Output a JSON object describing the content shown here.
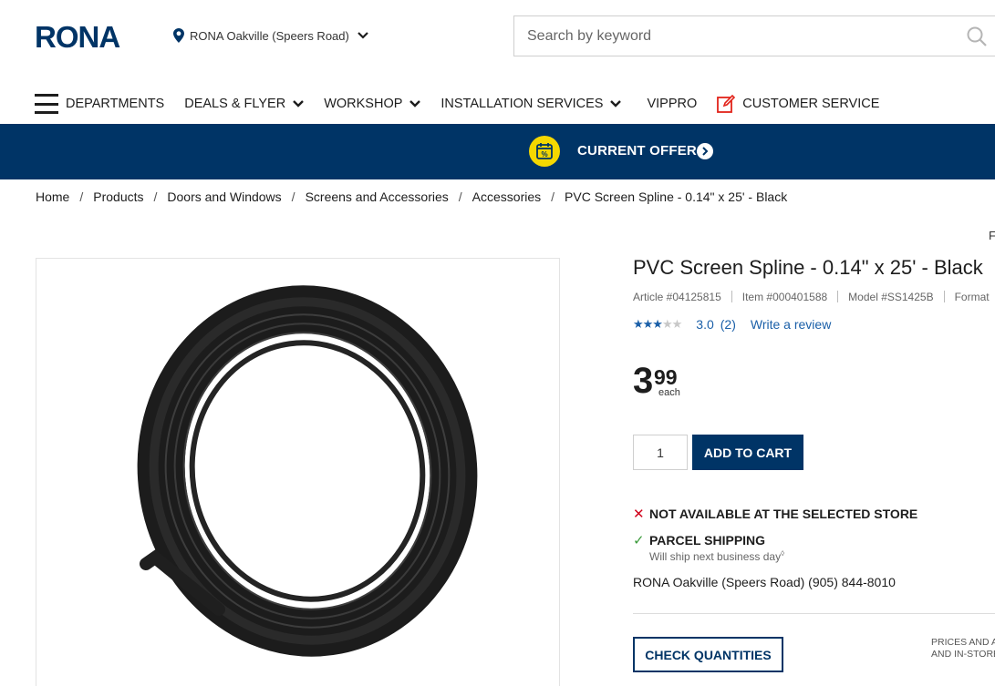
{
  "header": {
    "logo_text": "RONA",
    "store_name": "RONA Oakville (Speers Road)",
    "search_placeholder": "Search by keyword"
  },
  "nav": {
    "items": [
      {
        "label": "DEPARTMENTS",
        "icon": "hamburger-menu-icon"
      },
      {
        "label": "DEALS & FLYER",
        "icon": "chevron-down-icon"
      },
      {
        "label": "WORKSHOP",
        "icon": "chevron-down-icon"
      },
      {
        "label": "INSTALLATION SERVICES",
        "icon": "chevron-down-icon"
      },
      {
        "label": "VIPPRO",
        "icon": ""
      },
      {
        "label": "CUSTOMER SERVICE",
        "icon": "edit-icon"
      }
    ]
  },
  "offers": {
    "label": "CURRENT OFFERS",
    "colors": {
      "bar": "#003466",
      "badge": "#f5d800"
    }
  },
  "breadcrumb": [
    "Home",
    "Products",
    "Doors and Windows",
    "Screens and Accessories",
    "Accessories",
    "PVC Screen Spline - 0.14\" x 25' - Black"
  ],
  "cut_right_text": "F",
  "product": {
    "title": "PVC Screen Spline - 0.14\" x 25' - Black",
    "article": "Article #04125815",
    "item": "Item #000401588",
    "model": "Model #SS1425B",
    "format": "Format",
    "rating": {
      "stars_filled": 3,
      "stars_total": 5,
      "value": "3.0",
      "count": "(2)",
      "write_review": "Write a review"
    },
    "price": {
      "dollars": "3",
      "cents": "99",
      "unit": "each"
    },
    "quantity": "1",
    "add_to_cart": "ADD TO CART",
    "availability": {
      "not_available": "NOT AVAILABLE AT THE SELECTED STORE",
      "parcel_shipping": "PARCEL SHIPPING",
      "ship_note": "Will ship next business day",
      "ship_note_mark": "◊"
    },
    "store_line": "RONA Oakville (Speers Road) (905) 844-8010",
    "check_quantities": "CHECK QUANTITIES",
    "prices_note_1": "PRICES AND A",
    "prices_note_2": "AND IN-STORE"
  },
  "colors": {
    "brand_blue": "#003466",
    "link_blue": "#1a5fa8",
    "error_red": "#d0021b",
    "ok_green": "#3b9b3b"
  }
}
